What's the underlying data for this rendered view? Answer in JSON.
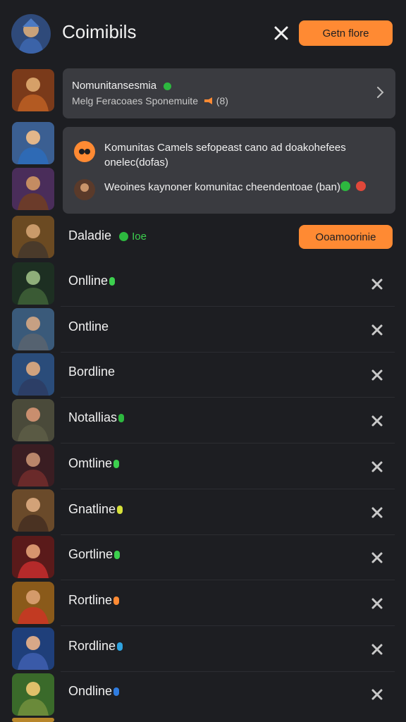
{
  "header": {
    "title": "Coimibils",
    "cta_label": "Getn flore"
  },
  "card1": {
    "title": "Nomunitansesmia",
    "subtitle": "Melg Feracoaes Sponemuite",
    "subtitle_count": "(8)"
  },
  "card2": {
    "message1": "Komunitas Camels sefopeast cano ad doakohefees onelec(dofas)",
    "message2": "Weoines kaynoner komunitac cheendentoae (ban)"
  },
  "row_first": {
    "label": "Daladie",
    "badge": "Ioe",
    "cta_label": "Ooamoorinie"
  },
  "rows": [
    {
      "label": "Onlline",
      "status_color": "#3ccf4e"
    },
    {
      "label": "Ontline",
      "status_color": ""
    },
    {
      "label": "Bordline",
      "status_color": ""
    },
    {
      "label": "Notallias",
      "status_color": "#2db83f"
    },
    {
      "label": "Omtline",
      "status_color": "#3ccf4e"
    },
    {
      "label": "Gnatline",
      "status_color": "#d6e03a"
    },
    {
      "label": "Gortline",
      "status_color": "#3ccf4e"
    },
    {
      "label": "Rortline",
      "status_color": "#ff8a33"
    },
    {
      "label": "Rordline",
      "status_color": "#2fa3e0"
    },
    {
      "label": "Ondline",
      "status_color": "#2f7ce0"
    }
  ],
  "colors": {
    "accent": "#ff8a33",
    "background": "#1d1e22",
    "card": "#3a3b40",
    "online": "#3ccf4e",
    "danger": "#e0483a"
  },
  "icons": {
    "close": "close-icon",
    "chevron": "chevron-right-icon",
    "megaphone": "megaphone-icon"
  }
}
